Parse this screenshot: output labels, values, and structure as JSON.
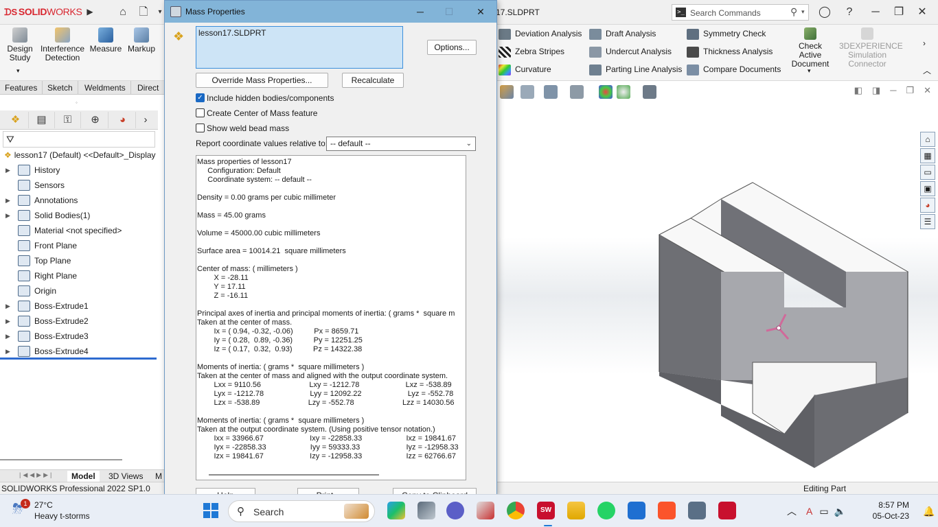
{
  "app": {
    "title": "SOLIDWORKS",
    "document_name_partial": "17.SLDPRT",
    "search": {
      "placeholder": "Search Commands"
    }
  },
  "command_manager": {
    "big_tools": [
      {
        "label": "Design\nStudy"
      },
      {
        "label": "Interference\nDetection"
      },
      {
        "label": "Measure"
      },
      {
        "label": "Markup"
      }
    ],
    "small_tools": [
      {
        "label": "Deviation Analysis",
        "icon": "deviation-icon"
      },
      {
        "label": "Zebra Stripes",
        "icon": "zebra-icon"
      },
      {
        "label": "Curvature",
        "icon": "curvature-icon"
      },
      {
        "label": "Draft Analysis",
        "icon": "draft-icon"
      },
      {
        "label": "Undercut Analysis",
        "icon": "undercut-icon"
      },
      {
        "label": "Parting Line Analysis",
        "icon": "parting-line-icon"
      },
      {
        "label": "Symmetry Check",
        "icon": "symmetry-icon"
      },
      {
        "label": "Thickness Analysis",
        "icon": "thickness-icon"
      },
      {
        "label": "Compare Documents",
        "icon": "compare-icon"
      }
    ],
    "check_active": "Check Active\nDocument",
    "experience": "3DEXPERIENCE\nSimulation\nConnector",
    "tabs": [
      "Features",
      "Sketch",
      "Weldments",
      "Direct E"
    ]
  },
  "feature_tree": {
    "root": "lesson17 (Default) <<Default>_Display",
    "items": [
      {
        "label": "History",
        "expandable": true
      },
      {
        "label": "Sensors",
        "expandable": false
      },
      {
        "label": "Annotations",
        "expandable": true
      },
      {
        "label": "Solid Bodies(1)",
        "expandable": true
      },
      {
        "label": "Material <not specified>",
        "expandable": false
      },
      {
        "label": "Front Plane",
        "expandable": false
      },
      {
        "label": "Top Plane",
        "expandable": false
      },
      {
        "label": "Right Plane",
        "expandable": false
      },
      {
        "label": "Origin",
        "expandable": false
      },
      {
        "label": "Boss-Extrude1",
        "expandable": true
      },
      {
        "label": "Boss-Extrude2",
        "expandable": true
      },
      {
        "label": "Boss-Extrude3",
        "expandable": true
      },
      {
        "label": "Boss-Extrude4",
        "expandable": true
      }
    ]
  },
  "bottom_tabs": [
    "Model",
    "3D Views",
    "M"
  ],
  "status": {
    "left": "SOLIDWORKS Professional 2022 SP1.0",
    "right": "Editing Part"
  },
  "mass_dialog": {
    "title": "Mass Properties",
    "selected": "lesson17.SLDPRT",
    "options_btn": "Options...",
    "override_btn": "Override Mass Properties...",
    "recalc_btn": "Recalculate",
    "checks": [
      {
        "label": "Include hidden bodies/components",
        "checked": true
      },
      {
        "label": "Create Center of Mass feature",
        "checked": false
      },
      {
        "label": "Show weld bead mass",
        "checked": false
      }
    ],
    "report_label": "Report coordinate values relative to:",
    "report_value": "-- default --",
    "output_lines": [
      "Mass properties of lesson17",
      "     Configuration: Default",
      "     Coordinate system: -- default --",
      "",
      "Density = 0.00 grams per cubic millimeter",
      "",
      "Mass = 45.00 grams",
      "",
      "Volume = 45000.00 cubic millimeters",
      "",
      "Surface area = 10014.21  square millimeters",
      "",
      "Center of mass: ( millimeters )",
      "        X = -28.11",
      "        Y = 17.11",
      "        Z = -16.11",
      "",
      "Principal axes of inertia and principal moments of inertia: ( grams *  square m",
      "Taken at the center of mass.",
      "        Ix = ( 0.94, -0.32, -0.06)          Px = 8659.71",
      "        Iy = ( 0.28,  0.89, -0.36)          Py = 12251.25",
      "        Iz = ( 0.17,  0.32,  0.93)          Pz = 14322.38",
      "",
      "Moments of inertia: ( grams *  square millimeters )",
      "Taken at the center of mass and aligned with the output coordinate system.",
      "        Lxx = 9110.56                       Lxy = -1212.78                      Lxz = -538.89",
      "        Lyx = -1212.78                      Lyy = 12092.22                      Lyz = -552.78",
      "        Lzx = -538.89                       Lzy = -552.78                       Lzz = 14030.56",
      "",
      "Moments of inertia: ( grams *  square millimeters )",
      "Taken at the output coordinate system. (Using positive tensor notation.)",
      "        Ixx = 33966.67                      Ixy = -22858.33                     Ixz = 19841.67",
      "        Iyx = -22858.33                     Iyy = 59333.33                      Iyz = -12958.33",
      "        Izx = 19841.67                      Izy = -12958.33                     Izz = 62766.67"
    ],
    "bottom_buttons": [
      "Help",
      "Print...",
      "Copy to Clipboard"
    ]
  },
  "taskbar": {
    "weather_temp": "27°C",
    "weather_cond": "Heavy t-storms",
    "weather_badge": "1",
    "search": "Search",
    "time": "8:57 PM",
    "date": "05-Oct-23"
  }
}
